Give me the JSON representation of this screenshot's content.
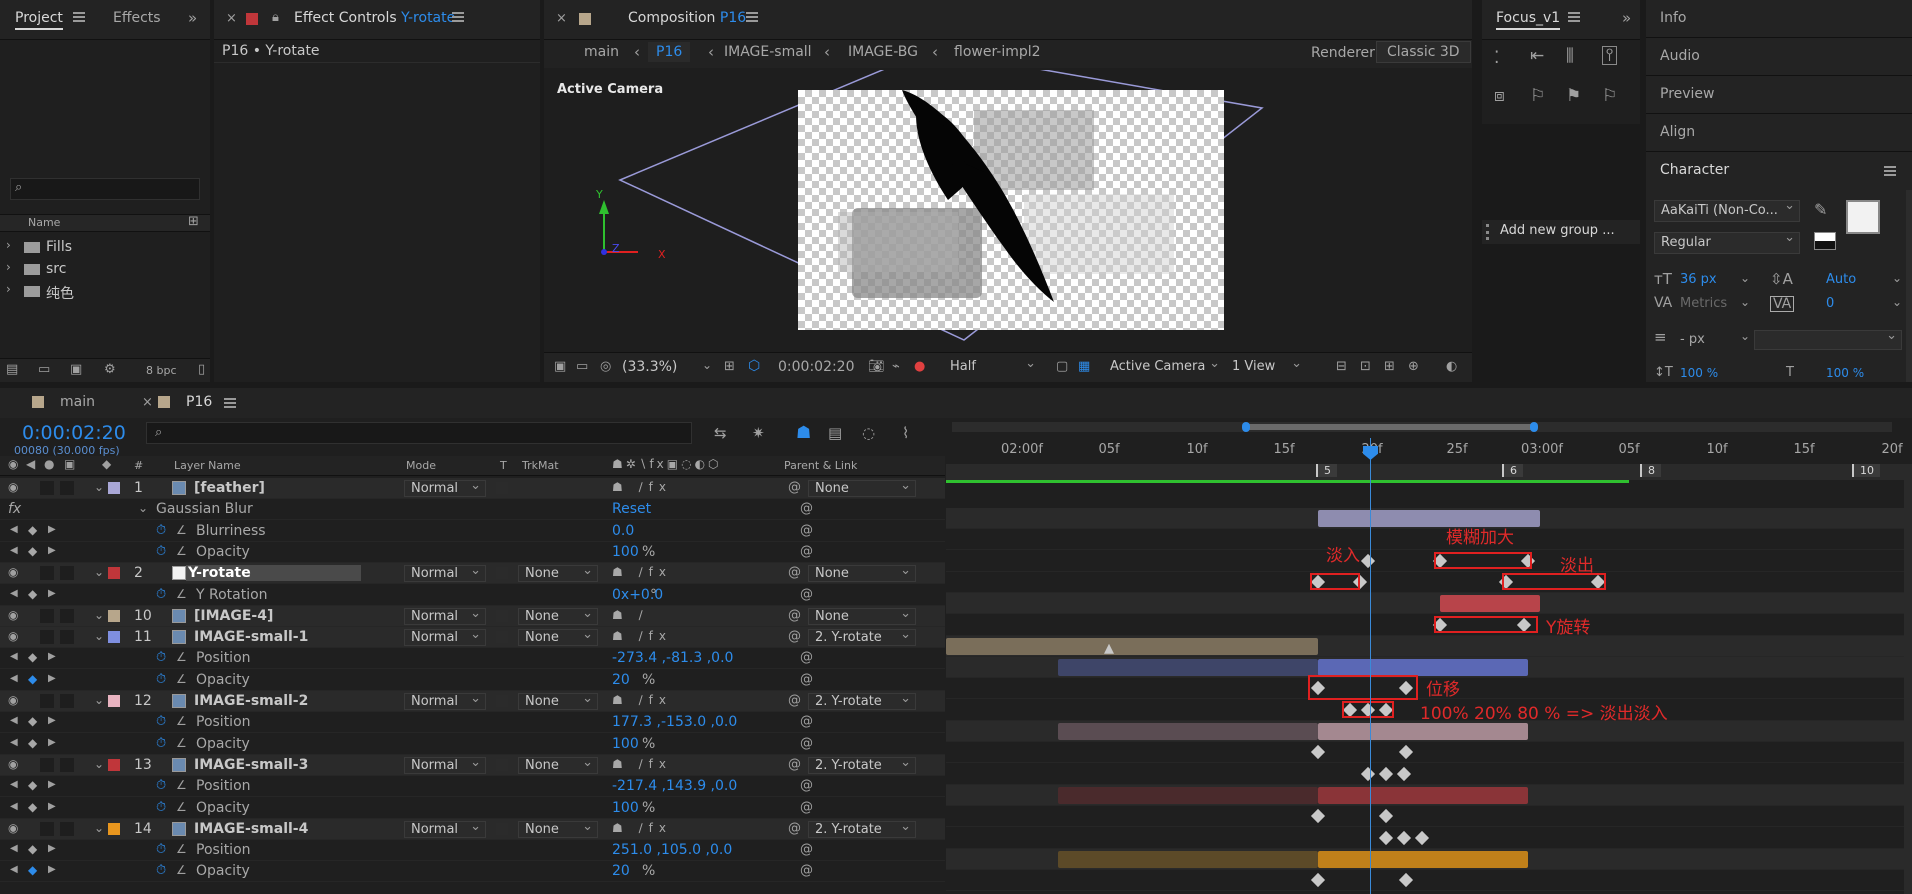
{
  "project_panel": {
    "tab_project": "Project",
    "tab_effects": "Effects",
    "search_placeholder": "",
    "col_name": "Name",
    "items": [
      {
        "label": "Fills"
      },
      {
        "label": "src"
      },
      {
        "label": "纯色"
      }
    ],
    "bpc": "8 bpc"
  },
  "effect_controls": {
    "tab_label": "Effect Controls",
    "tab_layer": "Y-rotate",
    "subtitle": "P16 • Y-rotate"
  },
  "composition": {
    "tab_label": "Composition",
    "tab_comp": "P16",
    "breadcrumbs": [
      "main",
      "P16",
      "IMAGE-small",
      "IMAGE-BG",
      "flower-impl2"
    ],
    "renderer_label": "Renderer:",
    "renderer_value": "Classic 3D",
    "view_label": "Active Camera",
    "zoom": "(33.3%)",
    "timecode": "0:00:02:20",
    "resolution": "Half",
    "camera": "Active Camera",
    "views": "1 View",
    "axis_y": "Y",
    "axis_z": "Z",
    "axis_x": "X"
  },
  "focus_panel": {
    "tab_label": "Focus_v1",
    "add_group": "Add new group ..."
  },
  "right_panel": {
    "items": [
      "Info",
      "Audio",
      "Preview",
      "Align"
    ],
    "character": "Character",
    "font": "AaKaiTi (Non-Co...",
    "style": "Regular",
    "size": "36 px",
    "leading": "Auto",
    "kerning": "Metrics",
    "tracking": "0",
    "stroke": "- px",
    "vscale": "100 %",
    "hscale": "100 %"
  },
  "timeline": {
    "tab_main": "main",
    "tab_p16": "P16",
    "timecode": "0:00:02:20",
    "frames": "00080 (30.000 fps)",
    "search_placeholder": "",
    "col_hash": "#",
    "col_layer": "Layer Name",
    "col_mode": "Mode",
    "col_t": "T",
    "col_trkmat": "TrkMat",
    "col_parent": "Parent & Link",
    "ruler": [
      "02:00f",
      "05f",
      "10f",
      "15f",
      "20f",
      "25f",
      "03:00f",
      "05f",
      "10f",
      "15f",
      "20f"
    ],
    "markers": [
      "5",
      "6",
      "8",
      "10"
    ],
    "rows": [
      {
        "num": "1",
        "name": "[feather]",
        "mode": "Normal",
        "trkmat": "",
        "parent": "None",
        "color": "#a9a7d6",
        "bold": true
      },
      {
        "name": "Gaussian Blur",
        "value": "Reset",
        "effect": true
      },
      {
        "name": "Blurriness",
        "value": "0.0"
      },
      {
        "name": "Opacity",
        "value": "100",
        "unit": "%"
      },
      {
        "num": "2",
        "name": "Y-rotate",
        "mode": "Normal",
        "trkmat": "None",
        "parent": "None",
        "color": "#c0363a",
        "selected": true
      },
      {
        "name": "Y Rotation",
        "value": "0x+0.0",
        "unit": "°"
      },
      {
        "num": "10",
        "name": "[IMAGE-4]",
        "mode": "Normal",
        "trkmat": "None",
        "parent": "None",
        "color": "#b7a68b",
        "bold": true
      },
      {
        "num": "11",
        "name": "IMAGE-small-1",
        "mode": "Normal",
        "trkmat": "None",
        "parent": "2. Y-rotate",
        "color": "#7f8fe0"
      },
      {
        "name": "Position",
        "value": "-273.4 ,-81.3 ,0.0"
      },
      {
        "name": "Opacity",
        "value": "20",
        "unit": "%"
      },
      {
        "num": "12",
        "name": "IMAGE-small-2",
        "mode": "Normal",
        "trkmat": "None",
        "parent": "2. Y-rotate",
        "color": "#e8b3c0"
      },
      {
        "name": "Position",
        "value": "177.3 ,-153.0 ,0.0"
      },
      {
        "name": "Opacity",
        "value": "100",
        "unit": "%"
      },
      {
        "num": "13",
        "name": "IMAGE-small-3",
        "mode": "Normal",
        "trkmat": "None",
        "parent": "2. Y-rotate",
        "color": "#c0363a"
      },
      {
        "name": "Position",
        "value": "-217.4 ,143.9 ,0.0"
      },
      {
        "name": "Opacity",
        "value": "100",
        "unit": "%"
      },
      {
        "num": "14",
        "name": "IMAGE-small-4",
        "mode": "Normal",
        "trkmat": "None",
        "parent": "2. Y-rotate",
        "color": "#e8961e"
      },
      {
        "name": "Position",
        "value": "251.0 ,105.0 ,0.0"
      },
      {
        "name": "Opacity",
        "value": "20",
        "unit": "%"
      }
    ],
    "annotations": {
      "fade_in": "淡入",
      "blur_up": "模糊加大",
      "fade_out": "淡出",
      "y_rotate": "Y旋转",
      "move": "位移",
      "opacity_note": "100% 20% 80 % => 淡出淡入"
    }
  },
  "colors": {
    "accent": "#2d8ceb",
    "annotation": "#e02020"
  }
}
